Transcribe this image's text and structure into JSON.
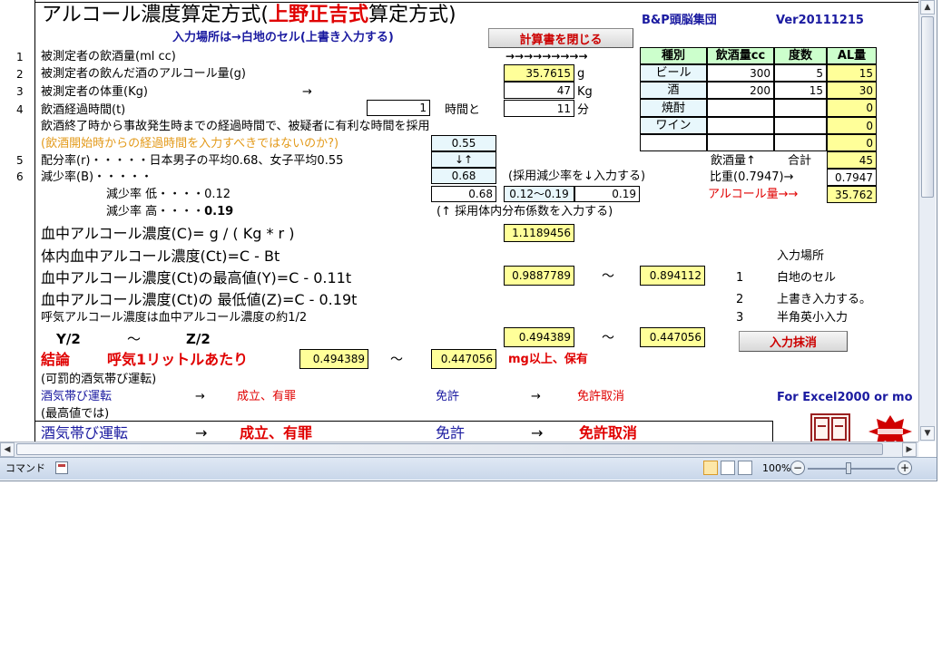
{
  "header": {
    "title_prefix": "アルコール濃度算定方式(",
    "title_red": "上野正吉式",
    "title_suffix": "算定方式)",
    "group": "B&P頭脳集団",
    "version": "Ver20111215",
    "input_hint": "入力場所は→白地のセル(上書き入力する)",
    "close_button": "計算書を閉じる",
    "arrows": "→→→→→→→→→"
  },
  "rows": {
    "n1": "1",
    "n2": "2",
    "n3": "3",
    "n4": "4",
    "n5": "5",
    "n6": "6",
    "r1": "被測定者の飲酒量(ml cc)",
    "r2": "被測定者の飲んだ酒のアルコール量(g)",
    "r3": "被測定者の体重(Kg)",
    "r3_arrow": "→",
    "r4": "飲酒経過時間(t)",
    "r4_hours": "1",
    "r4_hours_label": "時間と",
    "note1": "飲酒終了時から事故発生時までの経過時間で、被疑者に有利な時間を採用",
    "note2": "(飲酒開始時からの経過時間を入力すべきではないのか?)",
    "r5": "配分率(r)・・・・・日本男子の平均0.68、女子平均0.55",
    "r6": "減少率(B)・・・・・",
    "low": "減少率 低・・・・0.12",
    "high_prefix": "減少率 高・・・・",
    "high_val": "0.19",
    "adopt_rate": "(採用減少率を↓入力する)",
    "adopt_dist": "(↑ 採用体内分布係数を入力する)"
  },
  "values": {
    "alcohol_g": "35.7615",
    "alcohol_unit": "g",
    "weight": "47",
    "weight_unit": "Kg",
    "minutes": "11",
    "minutes_unit": "分",
    "r_female": "0.55",
    "r_arrows": "↓↑",
    "r_male": "0.68",
    "b_input": "0.68",
    "b_range": "0.12～0.19",
    "b_val": "0.19",
    "c_val": "1.1189456",
    "ymax": "0.9887789",
    "ymax2": "0.894112",
    "y2": "0.494389",
    "z2": "0.447056",
    "res1": "0.494389",
    "res2": "0.447056",
    "tilde": "～"
  },
  "table": {
    "headers": [
      "種別",
      "飲酒量cc",
      "度数",
      "AL量"
    ],
    "rows": [
      {
        "type": "ビール",
        "amount": "300",
        "degree": "5",
        "al": "15"
      },
      {
        "type": "酒",
        "amount": "200",
        "degree": "15",
        "al": "30"
      },
      {
        "type": "焼酎",
        "amount": "",
        "degree": "",
        "al": "0"
      },
      {
        "type": "ワイン",
        "amount": "",
        "degree": "",
        "al": "0"
      },
      {
        "type": "",
        "amount": "",
        "degree": "",
        "al": "0"
      }
    ],
    "total_label": "飲酒量↑",
    "sum_label": "合計",
    "total": "45",
    "sg_label": "比重(0.7947)→",
    "sg": "0.7947",
    "alc_label": "アルコール量→→",
    "alc": "35.762"
  },
  "formulas": {
    "c": "血中アルコール濃度(C)= g / ( Kg * r )",
    "ct": "体内血中アルコール濃度(Ct)=C - Bt",
    "y": "血中アルコール濃度(Ct)の最高値(Y)=C - 0.11t",
    "z": "血中アルコール濃度(Ct)の 最低値(Z)=C - 0.19t",
    "breath": "呼気アルコール濃度は血中アルコール濃度の約1/2",
    "y2": "Y/2",
    "z2": "Z/2"
  },
  "legend": {
    "title": "入力場所",
    "n1": "1",
    "i1": "白地のセル",
    "n2": "2",
    "i2": "上書き入力する。",
    "n3": "3",
    "i3": "半角英小入力",
    "clear_button": "入力抹消"
  },
  "conclusion": {
    "label": "結論",
    "per": "呼気1リットルあたり",
    "unit": "mg以上、保有",
    "penal": "(可罰的酒気帯び運転)",
    "dd": "酒気帯び運転",
    "arrow": "→",
    "guilty": "成立、有罪",
    "license": "免許",
    "revoke": "免許取消",
    "max": "(最高値では)",
    "excel": "For Excel2000 or mo"
  },
  "statusbar": {
    "mode": "コマンド",
    "zoom": "100%"
  }
}
